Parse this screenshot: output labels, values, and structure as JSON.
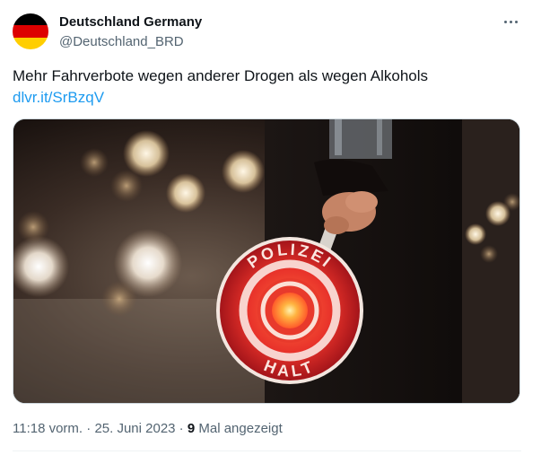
{
  "author": {
    "display_name": "Deutschland Germany",
    "handle": "@Deutschland_BRD",
    "avatar_colors": [
      "#000000",
      "#dd0000",
      "#ffce00"
    ]
  },
  "more_icon": "more-horizontal-icon",
  "tweet": {
    "text": "Mehr Fahrverbote wegen anderer Drogen als wegen Alkohols",
    "link": "dlvr.it/SrBzqV"
  },
  "media": {
    "sign_text_top": "POLIZEI",
    "sign_text_bottom": "HALT"
  },
  "meta": {
    "time": "11:18 vorm.",
    "separator1": " · ",
    "date": "25. Juni 2023",
    "separator2": " · ",
    "views_count": "9",
    "views_label": " Mal angezeigt"
  },
  "colors": {
    "text_primary": "#0f1419",
    "text_secondary": "#536471",
    "link": "#1d9bf0",
    "border": "#cfd9de"
  }
}
